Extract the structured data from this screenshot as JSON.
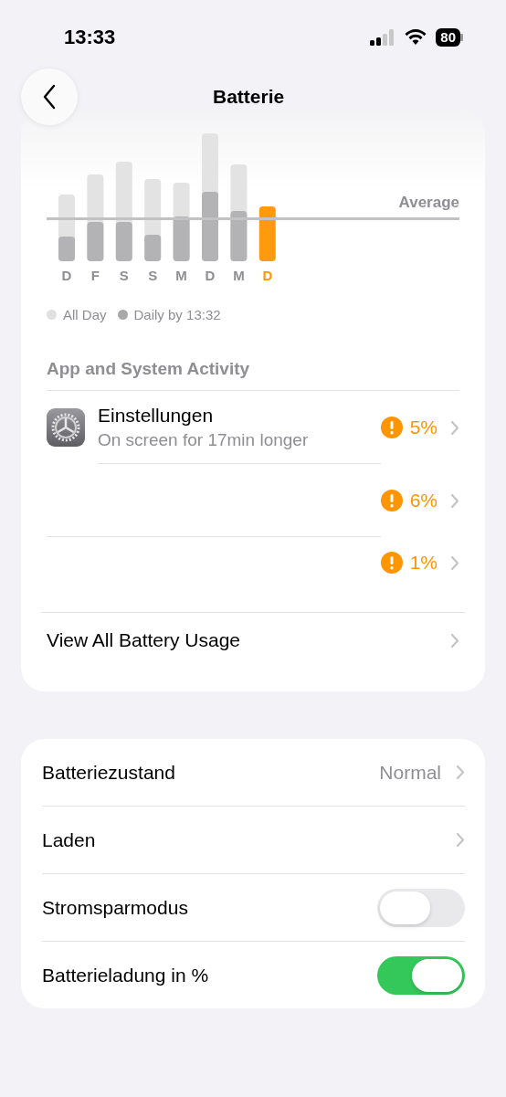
{
  "status_bar": {
    "time": "13:33",
    "battery": "80"
  },
  "nav": {
    "title": "Batterie"
  },
  "chart": {
    "average_label": "Average",
    "days": [
      {
        "label": "D",
        "selected": false
      },
      {
        "label": "F",
        "selected": false
      },
      {
        "label": "S",
        "selected": false
      },
      {
        "label": "S",
        "selected": false
      },
      {
        "label": "M",
        "selected": false
      },
      {
        "label": "D",
        "selected": false
      },
      {
        "label": "M",
        "selected": false
      },
      {
        "label": "D",
        "selected": true
      }
    ],
    "legend": [
      {
        "label": "All Day",
        "color": "#e0e0e0"
      },
      {
        "label": "Daily by 13:32",
        "color": "#a9a9a9"
      }
    ]
  },
  "activity": {
    "title": "App and System Activity",
    "apps": [
      {
        "name": "Einstellungen",
        "subtitle": "On screen for 17min longer",
        "percent": "5%",
        "warning": true
      },
      {
        "percent": "6%",
        "warning": true
      },
      {
        "percent": "1%",
        "warning": true
      }
    ],
    "view_all": "View All Battery Usage"
  },
  "settings": [
    {
      "kind": "link",
      "label": "Batteriezustand",
      "value": "Normal"
    },
    {
      "kind": "link",
      "label": "Laden"
    },
    {
      "kind": "toggle",
      "label": "Stromsparmodus",
      "on": false
    },
    {
      "kind": "toggle",
      "label": "Batterieladung in %",
      "on": true
    }
  ]
}
